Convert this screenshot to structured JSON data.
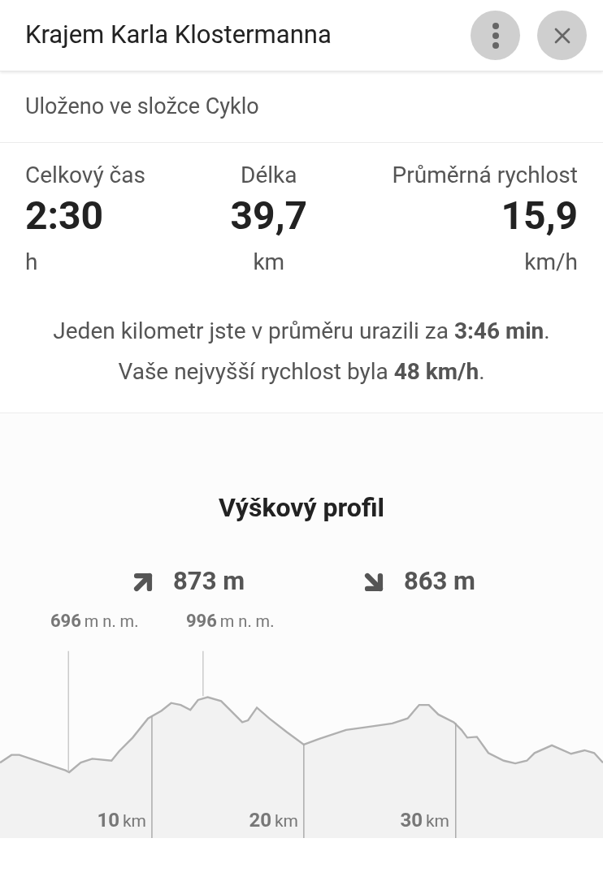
{
  "header": {
    "title": "Krajem Karla Klostermanna"
  },
  "folder": "Uloženo ve složce Cyklo",
  "stats": [
    {
      "label": "Celkový čas",
      "value": "2:30",
      "unit": "h"
    },
    {
      "label": "Délka",
      "value": "39,7",
      "unit": "km"
    },
    {
      "label": "Průměrná rychlost",
      "value": "15,9",
      "unit": "km/h"
    }
  ],
  "summary": [
    "Jeden kilometr jste v průměru urazili za **3:46 min**.",
    "Vaše nejvyšší rychlost byla **48 km/h**."
  ],
  "elevation": {
    "title": "Výškový profil",
    "ascent": "873 m",
    "descent": "863 m",
    "markers": [
      {
        "value": "696",
        "unit": "m n. m."
      },
      {
        "value": "996",
        "unit": "m n. m."
      }
    ],
    "distance_ticks": [
      {
        "value": "10",
        "unit": "km"
      },
      {
        "value": "20",
        "unit": "km"
      },
      {
        "value": "30",
        "unit": "km"
      }
    ]
  }
}
